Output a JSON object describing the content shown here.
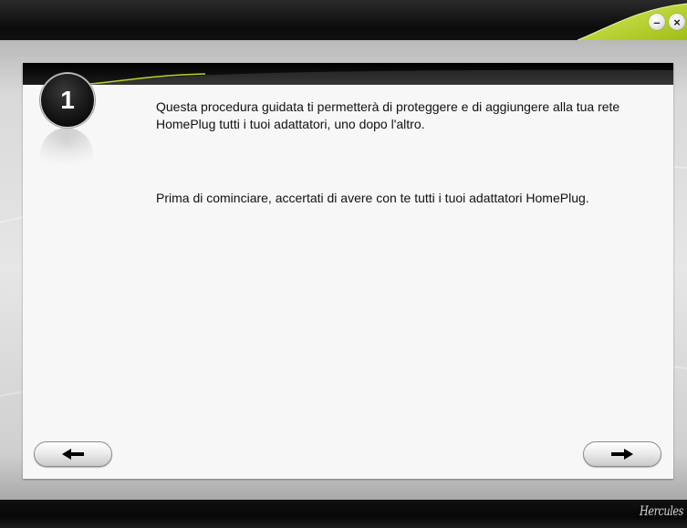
{
  "window": {
    "minimize_icon": "minimize-icon",
    "close_icon": "close-icon",
    "accent_color": "#b7d22b"
  },
  "step": {
    "number": "1"
  },
  "content": {
    "paragraph1": "Questa procedura guidata ti permetterà di proteggere e di aggiungere alla tua rete HomePlug tutti i tuoi adattatori, uno dopo l'altro.",
    "paragraph2": "Prima di cominciare, accertati di avere con te tutti i tuoi adattatori HomePlug."
  },
  "navigation": {
    "back_icon": "arrow-left-icon",
    "next_icon": "arrow-right-icon"
  },
  "footer": {
    "brand": "Hercules"
  }
}
